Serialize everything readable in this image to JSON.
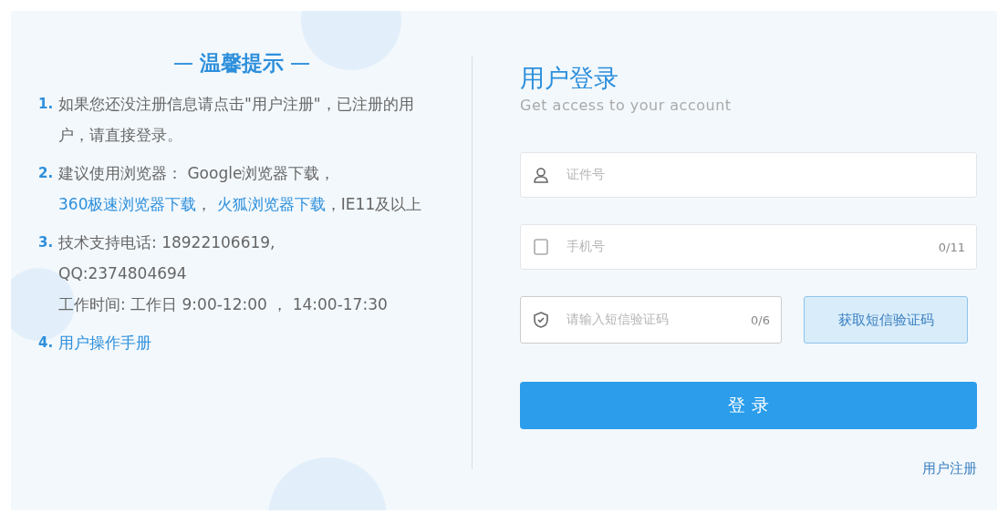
{
  "tips": {
    "title": "温馨提示",
    "items": [
      {
        "number": "1.",
        "segments": [
          {
            "kind": "text",
            "text": "如果您还没注册信息请点击\"用户注册\"，已注册的用户，请直接登录。"
          }
        ]
      },
      {
        "number": "2.",
        "segments": [
          {
            "kind": "text",
            "text": "建议使用浏览器： Google浏览器下载， "
          },
          {
            "kind": "link",
            "text": "360极速浏览器下载"
          },
          {
            "kind": "text",
            "text": "， "
          },
          {
            "kind": "link",
            "text": "火狐浏览器下载"
          },
          {
            "kind": "text",
            "text": "，IE11及以上"
          }
        ]
      },
      {
        "number": "3.",
        "segments": [
          {
            "kind": "line",
            "text": "技术支持电话: 18922106619,"
          },
          {
            "kind": "line",
            "text": "QQ:2374804694"
          },
          {
            "kind": "line",
            "text": "工作时间: 工作日 9:00-12:00 ，  14:00-17:30"
          }
        ]
      },
      {
        "number": "4.",
        "segments": [
          {
            "kind": "link",
            "text": "用户操作手册"
          }
        ]
      }
    ]
  },
  "login": {
    "title": "用户登录",
    "subtitle": "Get access to your account",
    "fields": [
      {
        "kind": "user",
        "placeholder": "证件号"
      },
      {
        "kind": "phone",
        "placeholder": "手机号",
        "counter": "0/11"
      },
      {
        "kind": "code",
        "placeholder": "请输入短信验证码",
        "counter": "0/6"
      }
    ],
    "code_button": "获取短信验证码",
    "submit": "登 录",
    "register_link": "用户注册"
  }
}
